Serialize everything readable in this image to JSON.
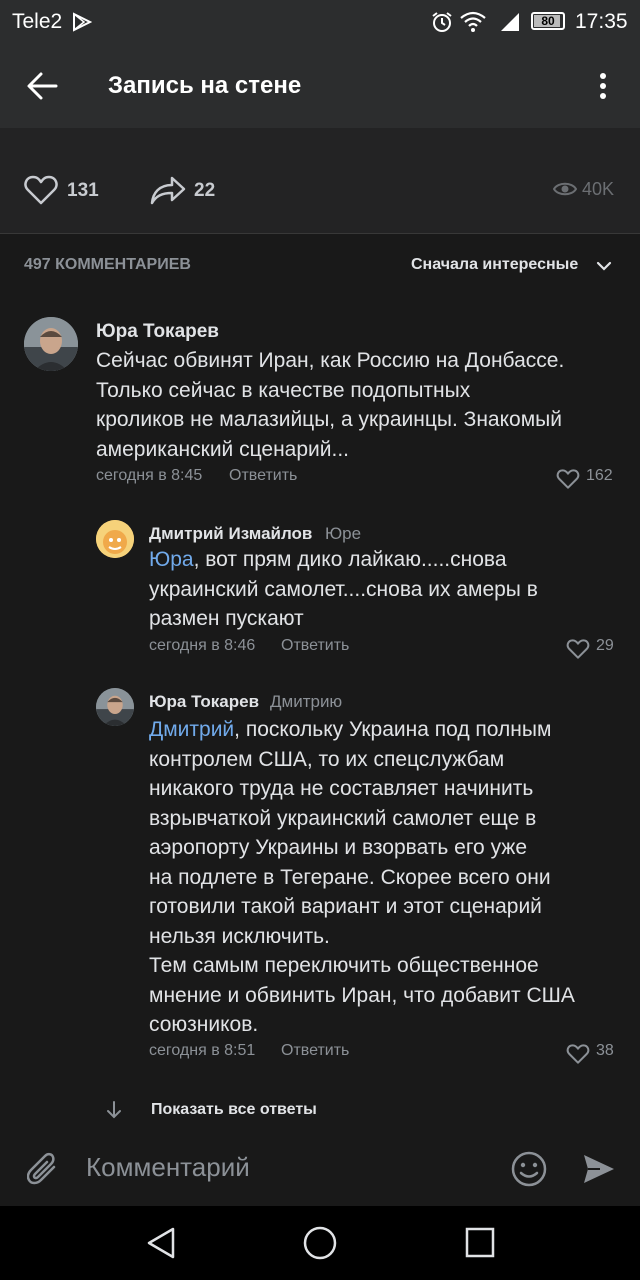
{
  "status": {
    "carrier": "Tele2",
    "battery": "80",
    "time": "17:35"
  },
  "header": {
    "title": "Запись на стене"
  },
  "post": {
    "likes": "131",
    "shares": "22",
    "views": "40K"
  },
  "comments_header": {
    "count_label": "497 КОММЕНТАРИЕВ",
    "sort_label": "Сначала интересные"
  },
  "comments": [
    {
      "author": "Юра Токарев",
      "lines": [
        "Сейчас обвинят Иран, как Россию на Донбассе.",
        "Только сейчас в качестве подопытных",
        "кроликов не малазийцы, а украинцы. Знакомый",
        "американский сценарий..."
      ],
      "time": "сегодня в 8:45",
      "reply_label": "Ответить",
      "likes": "162"
    }
  ],
  "replies": [
    {
      "author": "Дмитрий Измайлов",
      "reply_to": "Юре",
      "mention": "Юра",
      "first_line_rest": ", вот прям дико лайкаю.....снова",
      "lines": [
        "украинский самолет....снова их амеры в",
        "размен пускают"
      ],
      "time": "сегодня в 8:46",
      "reply_label": "Ответить",
      "likes": "29"
    },
    {
      "author": "Юра Токарев",
      "reply_to": "Дмитрию",
      "mention": "Дмитрий",
      "first_line_rest": ", поскольку Украина под полным",
      "lines": [
        "контролем США, то их спецслужбам",
        "никакого труда не составляет начинить",
        "взрывчаткой украинский самолет еще в",
        "аэропорту Украины и взорвать его уже",
        "на подлете в Тегеране. Скорее всего они",
        "готовили такой вариант и этот сценарий",
        "нельзя исключить.",
        "Тем самым переключить общественное",
        "мнение и обвинить Иран, что добавит США",
        "союзников."
      ],
      "time": "сегодня в 8:51",
      "reply_label": "Ответить",
      "likes": "38"
    }
  ],
  "show_all_replies": "Показать все ответы",
  "composer": {
    "placeholder": "Комментарий"
  },
  "colors": {
    "accent": "#71aaeb",
    "background": "#191919",
    "bar": "#2c2d2e"
  }
}
